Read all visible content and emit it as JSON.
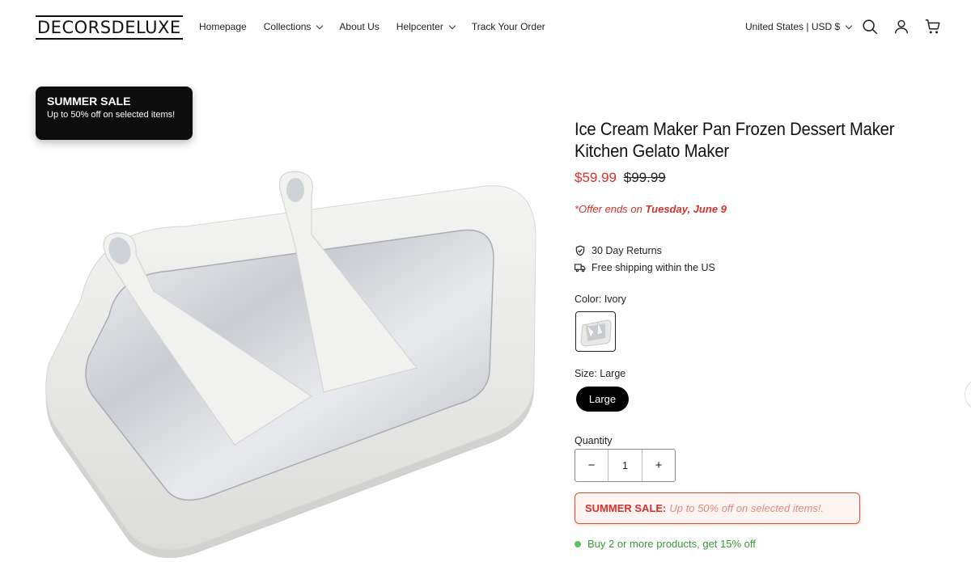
{
  "header": {
    "logo": "DECORSDELUXE",
    "nav": [
      {
        "label": "Homepage",
        "dropdown": false
      },
      {
        "label": "Collections",
        "dropdown": true
      },
      {
        "label": "About Us",
        "dropdown": false
      },
      {
        "label": "Helpcenter",
        "dropdown": true
      },
      {
        "label": "Track Your Order",
        "dropdown": false
      }
    ],
    "currency": "United States | USD $",
    "icons": [
      "search-icon",
      "account-icon",
      "cart-icon"
    ]
  },
  "promo_card": {
    "title": "SUMMER SALE",
    "text": "Up to 50% off on selected items!"
  },
  "product": {
    "title": "Ice Cream Maker Pan Frozen Dessert Maker Kitchen Gelato Maker",
    "price_sale": "$59.99",
    "price_original": "$99.99",
    "offer_prefix": "*Offer ends on",
    "offer_date": "Tuesday, June 9",
    "features": [
      {
        "icon": "shield-check-icon",
        "text": "30 Day Returns"
      },
      {
        "icon": "truck-icon",
        "text": "Free shipping within the US"
      }
    ],
    "color_label": "Color: Ivory",
    "size_label": "Size: Large",
    "size_option": "Large",
    "quantity_label": "Quantity",
    "quantity": "1",
    "qty_minus": "−",
    "qty_plus": "+",
    "sale_banner_bold": "SUMMER SALE:",
    "sale_banner_text": "Up to 50% off on selected items!.",
    "bundle_offer": "Buy 2 or more products, get 15% off"
  },
  "colors": {
    "accent_red": "#d6312a",
    "bundle_green": "#3a9a3a",
    "promo_bg": "#0d0d0d"
  }
}
